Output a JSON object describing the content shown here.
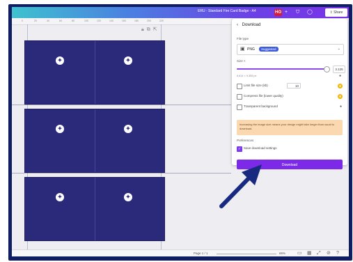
{
  "topbar": {
    "doc_title": "ERU - Standard Fire Card Badge - A4",
    "avatar_initials": "HO",
    "share_label": "Share"
  },
  "ruler": {
    "ticks": [
      "0",
      "20",
      "40",
      "60",
      "80",
      "100",
      "120",
      "140",
      "160",
      "180",
      "200",
      "220"
    ]
  },
  "download_panel": {
    "back_label": "Download",
    "file_type_label": "File type",
    "file_type_value": "PNG",
    "suggested_badge": "Suggested",
    "size_label": "Size ×",
    "size_value": "3.125",
    "size_dims": "6,614 × 9,355 px",
    "slider_fraction": 0.98,
    "limit_file_size_label": "Limit file size (kb)",
    "limit_file_size_value": "10",
    "compress_label": "Compress file (lower quality)",
    "transparent_label": "Transparent background",
    "warning_text": "Increasing the image size means your design might take longer than usual to download.",
    "preferences_label": "Preferences",
    "save_settings_label": "Save download settings",
    "save_settings_checked": true,
    "download_button_label": "Download"
  },
  "bottombar": {
    "page_label": "Page 1 / 1",
    "zoom_label": "66%"
  },
  "colors": {
    "card_fill": "#2b297a",
    "accent": "#7d2ae8",
    "frame": "#0f1e63"
  }
}
